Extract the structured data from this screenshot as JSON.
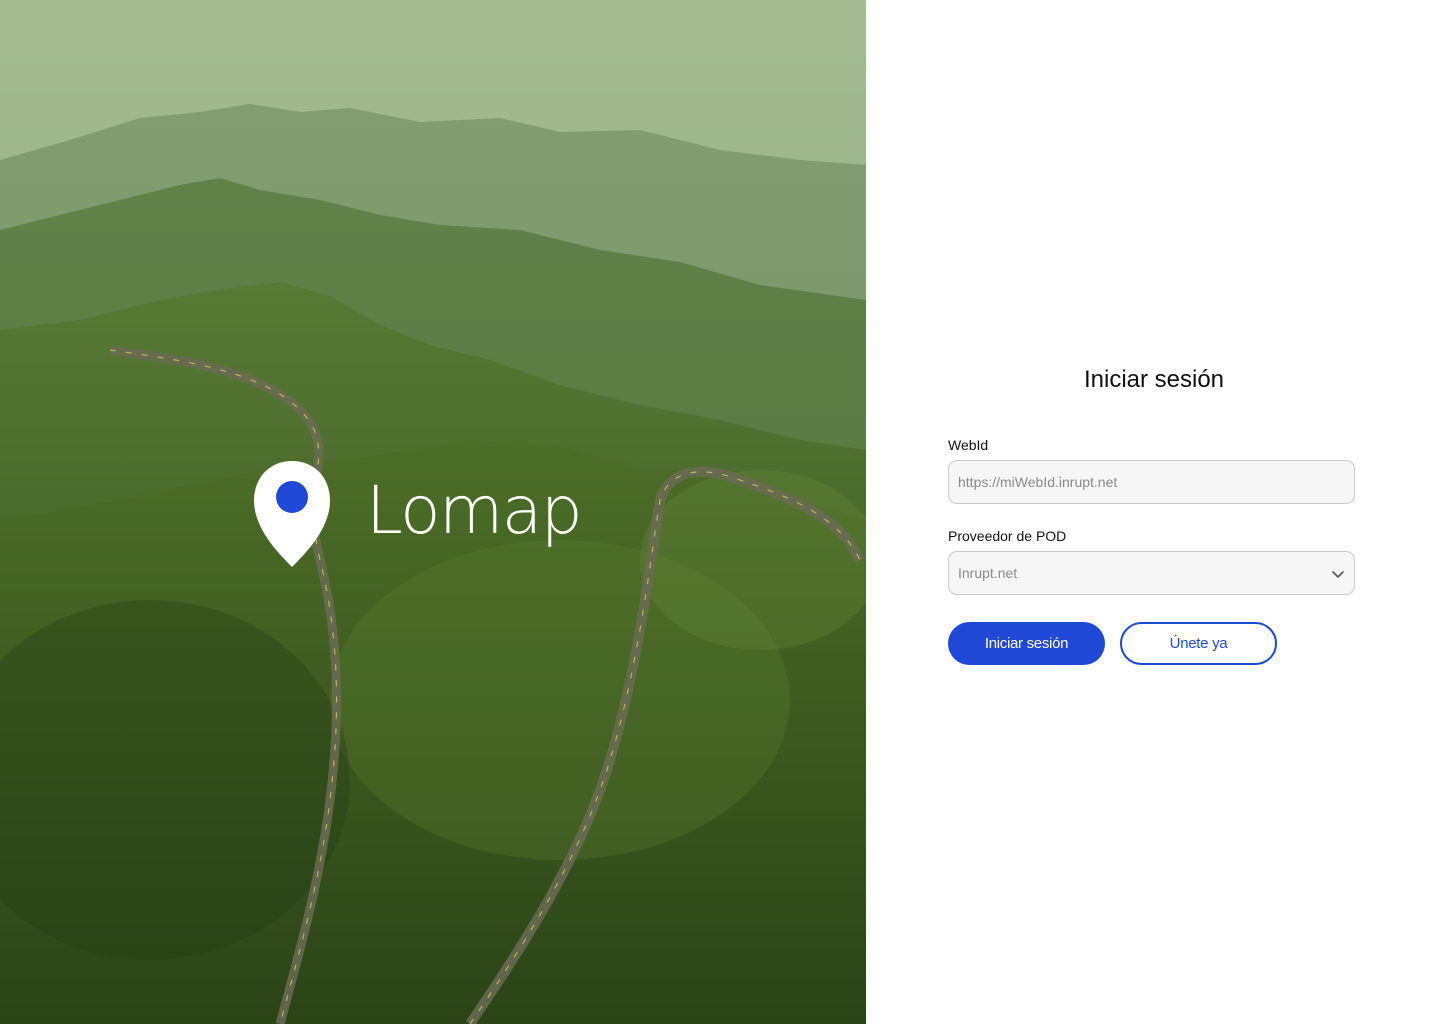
{
  "brand": {
    "name": "Lomap",
    "logo_icon": "map-pin-icon",
    "accent_color": "#1f48d6"
  },
  "login": {
    "title": "Iniciar sesión",
    "webid_label": "WebId",
    "webid_placeholder": "https://miWebId.inrupt.net",
    "pod_label": "Proveedor de POD",
    "pod_selected": "Inrupt.net",
    "pod_dropdown_icon": "chevron-down-icon",
    "login_button": "Iniciar sesión",
    "join_button": "Únete ya"
  }
}
